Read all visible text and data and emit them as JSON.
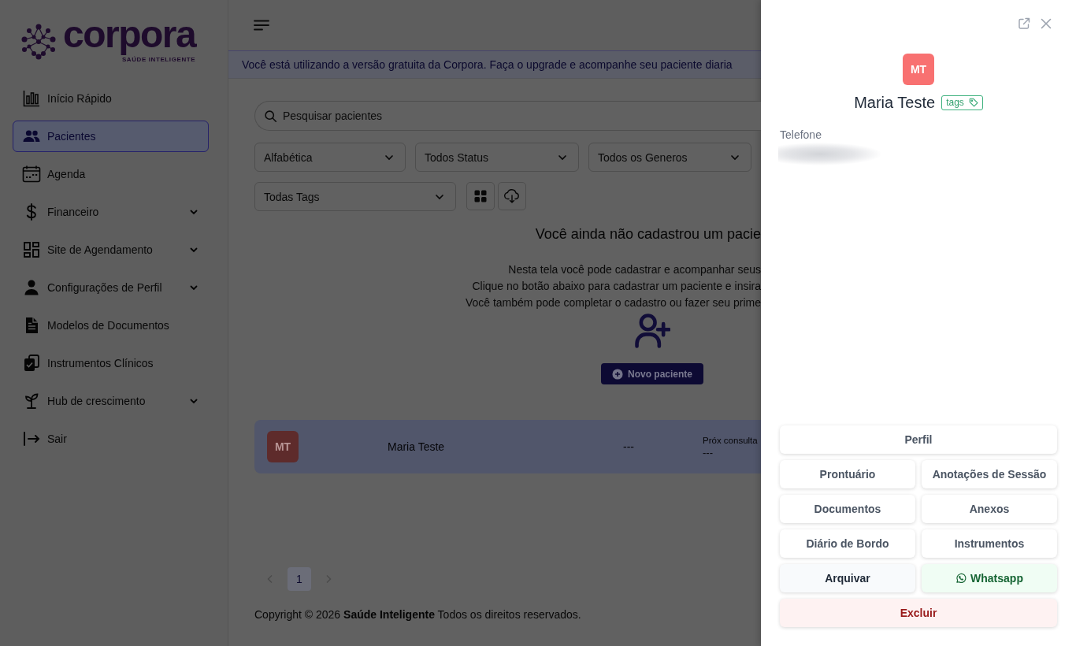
{
  "sidebar": {
    "logo": {
      "wordmark": "corpora",
      "tagline": "SAÚDE INTELIGENTE"
    },
    "items": [
      {
        "label": "Início Rápido",
        "selected": false,
        "expandable": false
      },
      {
        "label": "Pacientes",
        "selected": true,
        "expandable": false
      },
      {
        "label": "Agenda",
        "selected": false,
        "expandable": false
      },
      {
        "label": "Financeiro",
        "selected": false,
        "expandable": true
      },
      {
        "label": "Site de Agendamento",
        "selected": false,
        "expandable": true
      },
      {
        "label": "Configurações de Perfil",
        "selected": false,
        "expandable": true
      },
      {
        "label": "Modelos de Documentos",
        "selected": false,
        "expandable": false
      },
      {
        "label": "Instrumentos Clínicos",
        "selected": false,
        "expandable": false
      },
      {
        "label": "Hub de crescimento",
        "selected": false,
        "expandable": true
      },
      {
        "label": "Sair",
        "selected": false,
        "expandable": false
      }
    ]
  },
  "banner": {
    "text": "Você está utilizando a versão gratuita da Corpora. Faça o upgrade e acompanhe seu paciente diaria"
  },
  "search": {
    "placeholder": "Pesquisar pacientes"
  },
  "filters": [
    {
      "value": "Alfabética"
    },
    {
      "value": "Todos Status"
    },
    {
      "value": "Todos os Generos"
    },
    {
      "value": "Todas Tags"
    }
  ],
  "empty_state": {
    "title": "Você ainda não cadastrou um pacie",
    "lines": [
      "Nesta tela você pode cadastrar e acompanhar seus",
      "Clique no botão abaixo para cadastrar um paciente e insira",
      "Você também pode completar o cadastro ou fazer seu prime"
    ],
    "button": "Novo paciente"
  },
  "patients": [
    {
      "initials": "MT",
      "name": "Maria Teste",
      "column_3": "---",
      "next_label": "Próx consulta",
      "next_value": "---"
    }
  ],
  "pagination": {
    "pages": [
      {
        "label": "1",
        "selected": true
      }
    ]
  },
  "footer": "Copyright © 2026 **Saúde Inteligente** Todos os direitos reservados.",
  "drawer": {
    "avatar": "MT",
    "name": "Maria Teste",
    "tag": "tags",
    "fields": [
      {
        "label": "Telefone",
        "blurred": true
      }
    ],
    "actions": [
      {
        "label": "Perfil",
        "kind": "default",
        "wide": true
      },
      {
        "label": "Prontuário",
        "kind": "default",
        "wide": false
      },
      {
        "label": "Anotações de Sessão",
        "kind": "default",
        "wide": false
      },
      {
        "label": "Documentos",
        "kind": "default",
        "wide": false
      },
      {
        "label": "Anexos",
        "kind": "default",
        "wide": false
      },
      {
        "label": "Diário de Bordo",
        "kind": "default",
        "wide": false
      },
      {
        "label": "Instrumentos",
        "kind": "default",
        "wide": false
      },
      {
        "label": "Arquivar",
        "kind": "neutral",
        "wide": false
      },
      {
        "label": "Whatsapp",
        "kind": "whatsapp",
        "wide": false
      },
      {
        "label": "Excluir",
        "kind": "danger",
        "wide": true
      }
    ]
  }
}
